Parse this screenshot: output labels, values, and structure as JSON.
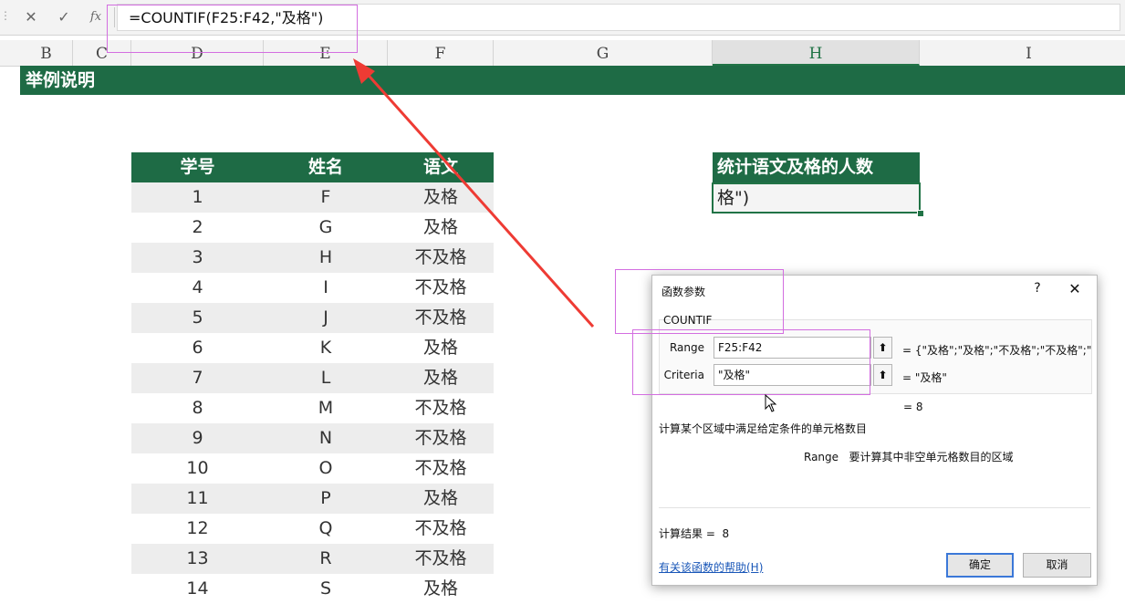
{
  "formula_bar": {
    "cancel_icon": "✕",
    "enter_icon": "✓",
    "fx_icon": "fx",
    "formula": "=COUNTIF(F25:F42,\"及格\")"
  },
  "columns": [
    "B",
    "C",
    "D",
    "E",
    "F",
    "G",
    "H",
    "I"
  ],
  "active_column": "H",
  "title": "举例说明",
  "table": {
    "headers": [
      "学号",
      "姓名",
      "语文"
    ],
    "rows": [
      [
        "1",
        "F",
        "及格"
      ],
      [
        "2",
        "G",
        "及格"
      ],
      [
        "3",
        "H",
        "不及格"
      ],
      [
        "4",
        "I",
        "不及格"
      ],
      [
        "5",
        "J",
        "不及格"
      ],
      [
        "6",
        "K",
        "及格"
      ],
      [
        "7",
        "L",
        "及格"
      ],
      [
        "8",
        "M",
        "不及格"
      ],
      [
        "9",
        "N",
        "不及格"
      ],
      [
        "10",
        "O",
        "不及格"
      ],
      [
        "11",
        "P",
        "及格"
      ],
      [
        "12",
        "Q",
        "不及格"
      ],
      [
        "13",
        "R",
        "不及格"
      ],
      [
        "14",
        "S",
        "及格"
      ]
    ]
  },
  "result_box": {
    "header": "统计语文及格的人数",
    "cell_text": "格\")"
  },
  "dialog": {
    "title": "函数参数",
    "help_icon": "?",
    "close_icon": "✕",
    "function_name": "COUNTIF",
    "args": [
      {
        "label": "Range",
        "value": "F25:F42",
        "preview": "=  {\"及格\";\"及格\";\"不及格\";\"不及格\";\""
      },
      {
        "label": "Criteria",
        "value": "\"及格\"",
        "preview": "=  \"及格\""
      }
    ],
    "total": "=  8",
    "description": "计算某个区域中满足给定条件的单元格数目",
    "arg_desc_label": "Range",
    "arg_desc_text": "要计算其中非空单元格数目的区域",
    "result_label": "计算结果 =",
    "result_value": "8",
    "help_link": "有关该函数的帮助(H)",
    "ok": "确定",
    "cancel": "取消"
  },
  "colors": {
    "header_green": "#1e6b45",
    "annotation_magenta": "#d36ee0",
    "arrow_red": "#ee3b34"
  }
}
